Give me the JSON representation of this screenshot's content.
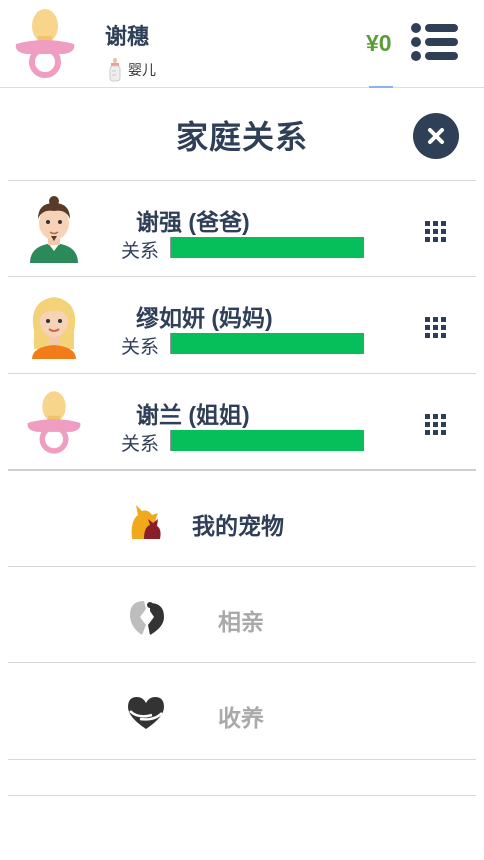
{
  "header": {
    "player_name": "谢穗",
    "life_stage": "婴儿",
    "money": "¥0",
    "avatar_icon": "pacifier-icon",
    "stage_icon": "baby-bottle-icon",
    "menu_icon": "list-menu-icon"
  },
  "page": {
    "title": "家庭关系",
    "close_icon": "close-icon"
  },
  "relationship_label": "关系",
  "members": [
    {
      "name": "谢强 (爸爸)",
      "avatar_icon": "father-avatar-icon",
      "relationship_level": 1.0
    },
    {
      "name": "缪如妍 (妈妈)",
      "avatar_icon": "mother-avatar-icon",
      "relationship_level": 1.0
    },
    {
      "name": "谢兰 (姐姐)",
      "avatar_icon": "pacifier-icon",
      "relationship_level": 1.0
    }
  ],
  "actions": [
    {
      "label": "我的宠物",
      "icon": "pets-icon",
      "enabled": true
    },
    {
      "label": "相亲",
      "icon": "broken-heart-icon",
      "enabled": false
    },
    {
      "label": "收养",
      "icon": "adopt-heart-icon",
      "enabled": false
    }
  ],
  "colors": {
    "primary_text": "#2e3f57",
    "money": "#5a9e35",
    "relationship_bar": "#07bf5a",
    "disabled_text": "#a9a9a9",
    "close_button": "#2f3f55"
  }
}
